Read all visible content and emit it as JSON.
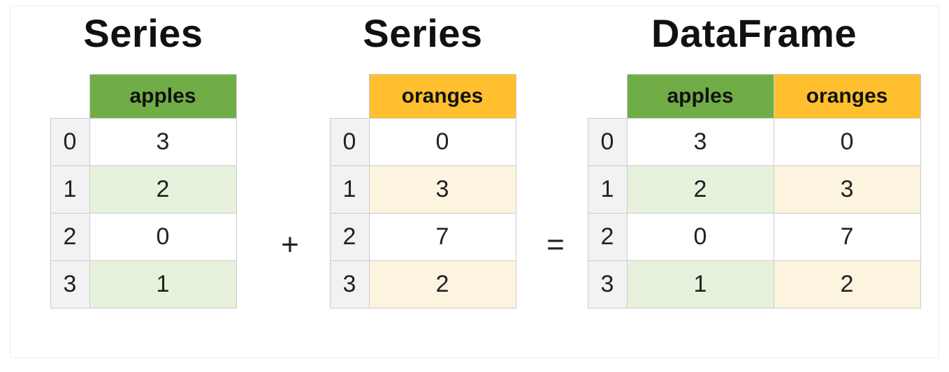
{
  "titles": {
    "series_a": "Series",
    "series_b": "Series",
    "result": "DataFrame"
  },
  "operators": {
    "plus": "+",
    "equals": "="
  },
  "columns": {
    "apples": "apples",
    "oranges": "oranges"
  },
  "index": [
    "0",
    "1",
    "2",
    "3"
  ],
  "series_a": {
    "column_key": "apples",
    "values": [
      "3",
      "2",
      "0",
      "1"
    ]
  },
  "series_b": {
    "column_key": "oranges",
    "values": [
      "0",
      "3",
      "7",
      "2"
    ]
  },
  "dataframe": {
    "columns_order": [
      "apples",
      "oranges"
    ],
    "rows": [
      {
        "apples": "3",
        "oranges": "0"
      },
      {
        "apples": "2",
        "oranges": "3"
      },
      {
        "apples": "0",
        "oranges": "7"
      },
      {
        "apples": "1",
        "oranges": "2"
      }
    ]
  },
  "colors": {
    "apples_header": "#70ad47",
    "oranges_header": "#ffbf2f",
    "apples_stripe": "#e7f2dc",
    "oranges_stripe": "#fcf4de",
    "index_bg": "#f2f2f2"
  },
  "chart_data": {
    "type": "table",
    "title": "Series + Series = DataFrame",
    "index": [
      0,
      1,
      2,
      3
    ],
    "series": [
      {
        "name": "apples",
        "values": [
          3,
          2,
          0,
          1
        ]
      },
      {
        "name": "oranges",
        "values": [
          0,
          3,
          7,
          2
        ]
      }
    ],
    "dataframe": {
      "columns": [
        "apples",
        "oranges"
      ],
      "data": [
        [
          3,
          0
        ],
        [
          2,
          3
        ],
        [
          0,
          7
        ],
        [
          1,
          2
        ]
      ]
    }
  }
}
